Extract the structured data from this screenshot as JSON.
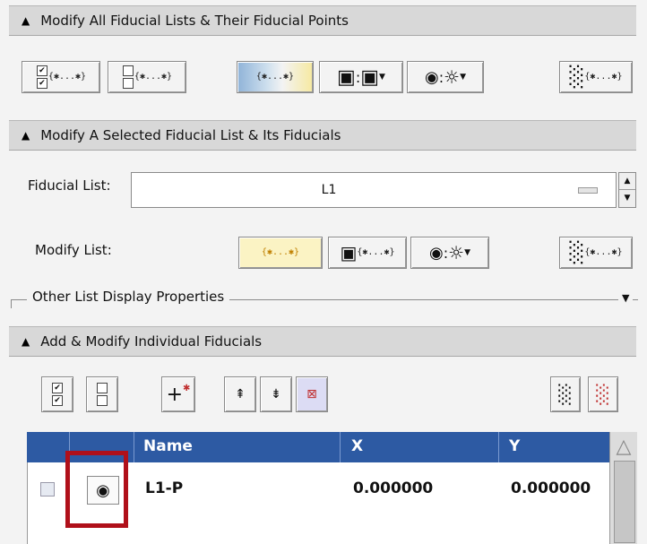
{
  "sections": {
    "all_lists": "Modify All Fiducial Lists & Their Fiducial Points",
    "selected_list": "Modify A Selected Fiducial List & Its Fiducials",
    "individual": "Add & Modify Individual Fiducials"
  },
  "fiducial_list": {
    "label": "Fiducial List:",
    "value": "L1"
  },
  "modify_list": {
    "label": "Modify List:"
  },
  "other_display": {
    "label": "Other List Display Properties"
  },
  "table": {
    "headers": [
      "Name",
      "X",
      "Y"
    ],
    "rows": [
      {
        "name": "L1-P",
        "x": "0.000000",
        "y": "0.000000"
      }
    ]
  },
  "icons": {
    "braces": "{✱...✱}",
    "eye": "◉",
    "sun": "☼",
    "lock": "▣",
    "trash": "░"
  }
}
